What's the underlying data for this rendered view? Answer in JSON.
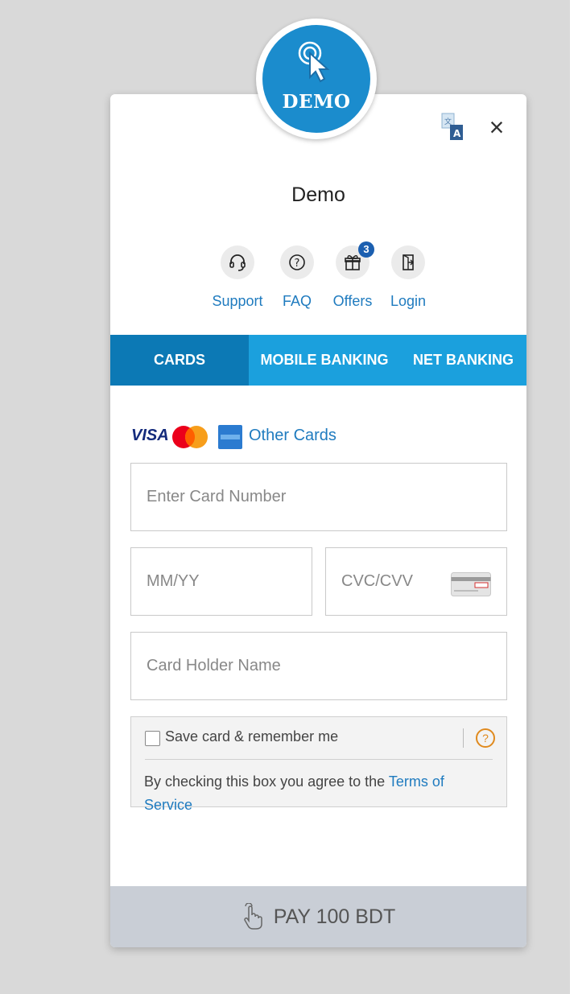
{
  "header": {
    "logo_text": "DEMO",
    "merchant_name": "Demo"
  },
  "icons": {
    "language": "translate-icon",
    "close": "close-icon",
    "support": "headset-icon",
    "faq": "question-icon",
    "offers": "gift-icon",
    "login": "login-icon",
    "pay": "tap-hand-icon"
  },
  "actions": {
    "support_label": "Support",
    "faq_label": "FAQ",
    "offers_label": "Offers",
    "offers_badge": "3",
    "login_label": "Login"
  },
  "tabs": [
    {
      "label": "CARDS",
      "active": true
    },
    {
      "label": "MOBILE BANKING",
      "active": false
    },
    {
      "label": "NET BANKING",
      "active": false
    }
  ],
  "cards": {
    "visa_label": "VISA",
    "other_cards_label": "Other Cards",
    "card_number_placeholder": "Enter Card Number",
    "expiry_placeholder": "MM/YY",
    "cvv_placeholder": "CVC/CVV",
    "holder_name_placeholder": "Card Holder Name",
    "save_label": "Save card & remember me",
    "save_help": "?",
    "terms_prefix": "By checking this box you agree to the ",
    "terms_link": "Terms of Service"
  },
  "pay": {
    "label": "PAY 100 BDT"
  },
  "colors": {
    "primary": "#1ba0dd",
    "active_tab": "#0c79b5",
    "link": "#1f7bbf",
    "pay_disabled": "#c9ced6"
  }
}
